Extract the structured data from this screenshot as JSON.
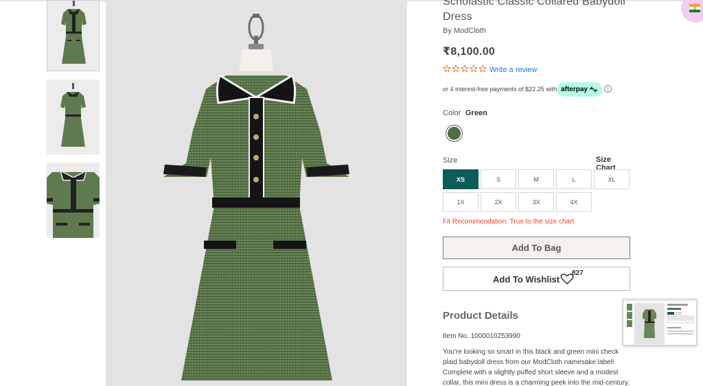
{
  "product": {
    "title": "Scholastic Classic Collared Babydoll Dress",
    "brand": "By ModCloth",
    "price": "₹8,100.00",
    "rating": 0,
    "review_link": "Write a review",
    "installment_text": "or 4 interest-free payments of $22.25 with",
    "afterpay_label": "afterpay",
    "info_glyph": "i"
  },
  "color": {
    "label": "Color",
    "value": "Green",
    "swatch": "#5e7a4e"
  },
  "size": {
    "label": "Size",
    "chart_link": "Size Chart",
    "options": [
      "XS",
      "S",
      "M",
      "L",
      "XL",
      "1X",
      "2X",
      "3X",
      "4X"
    ],
    "selected": "XS",
    "fit_recommendation": "Fit Recommendation: True to the size chart"
  },
  "actions": {
    "add_to_bag": "Add To Bag",
    "add_to_wishlist": "Add To Wishlist",
    "wishlist_count": "827"
  },
  "details": {
    "title": "Product Details",
    "item_no": "Item No. 1000010253990",
    "description": "You're looking so smart in this black and green mini check plaid babydoll dress from our ModCloth namesake label! Complete with a slightly puffed short sleeve and a modest collar, this mini dress is a charming peek into the mid-century."
  },
  "colors": {
    "accent": "#0d5c57",
    "fit_text": "#e8452c",
    "link": "#2a73d8",
    "afterpay": "#b2fce4"
  },
  "icons": [
    "search-icon",
    "star-icon",
    "heart-icon",
    "india-flag-icon"
  ]
}
